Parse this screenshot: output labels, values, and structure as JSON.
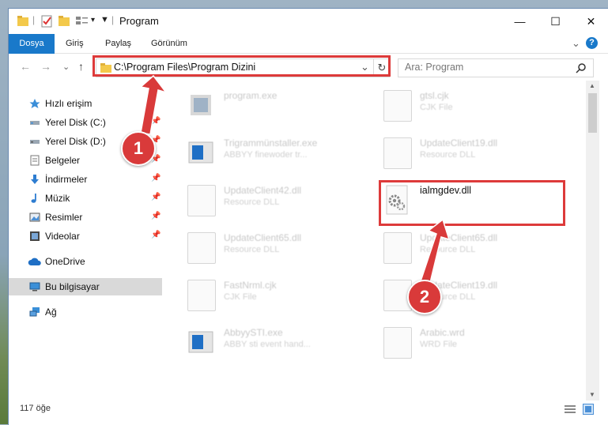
{
  "window": {
    "title": "Program",
    "controls": {
      "minimize": "—",
      "maximize": "☐",
      "close": "✕"
    }
  },
  "ribbon": {
    "tabs": [
      "Dosya",
      "Giriş",
      "Paylaş",
      "Görünüm"
    ],
    "expand": "⌄",
    "help": "?"
  },
  "nav": {
    "back": "←",
    "forward": "→",
    "recent": "⌄",
    "up": "↑",
    "address": "C:\\Program Files\\Program Dizini",
    "refresh": "↻",
    "dropdown": "⌄",
    "search_placeholder": "Ara: Program"
  },
  "sidebar": {
    "items": [
      {
        "label": "Hızlı erişim",
        "icon": "star-icon"
      },
      {
        "label": "Yerel Disk (C:)",
        "icon": "drive-icon",
        "pinned": true
      },
      {
        "label": "Yerel Disk (D:)",
        "icon": "drive-icon",
        "pinned": true
      },
      {
        "label": "Belgeler",
        "icon": "documents-icon",
        "pinned": true
      },
      {
        "label": "İndirmeler",
        "icon": "download-icon",
        "pinned": true
      },
      {
        "label": "Müzik",
        "icon": "music-icon",
        "pinned": true
      },
      {
        "label": "Resimler",
        "icon": "pictures-icon",
        "pinned": true
      },
      {
        "label": "Videolar",
        "icon": "video-icon",
        "pinned": true
      },
      {
        "label": "OneDrive",
        "icon": "cloud-icon"
      },
      {
        "label": "Bu bilgisayar",
        "icon": "computer-icon",
        "selected": true
      },
      {
        "label": "Ağ",
        "icon": "network-icon"
      }
    ]
  },
  "files": [
    {
      "name": "program.exe",
      "desc": ""
    },
    {
      "name": "gtsl.cjk",
      "desc": "CJK File"
    },
    {
      "name": "Trigrammünstaller.exe",
      "desc": "ABBYY finewoder tr..."
    },
    {
      "name": "UpdateClient19.dll",
      "desc": "Resource DLL"
    },
    {
      "name": "UpdateClient42.dll",
      "desc": "Resource DLL"
    },
    {
      "name": "ialmgdev.dll",
      "desc": ""
    },
    {
      "name": "UpdateClient65.dll",
      "desc": "Resource DLL"
    },
    {
      "name": "UpdateClient65.dll",
      "desc": "Resource DLL"
    },
    {
      "name": "FastNrml.cjk",
      "desc": "CJK File"
    },
    {
      "name": "UpdateClient19.dll",
      "desc": "Resource DLL"
    },
    {
      "name": "AbbyySTI.exe",
      "desc": "ABBY sti event hand..."
    },
    {
      "name": "Arabic.wrd",
      "desc": "WRD File"
    }
  ],
  "status": {
    "count": "117 öğe"
  },
  "annotations": {
    "step1": "1",
    "step2": "2"
  },
  "colors": {
    "accent": "#1979ca",
    "highlight": "#dd3a3a"
  }
}
